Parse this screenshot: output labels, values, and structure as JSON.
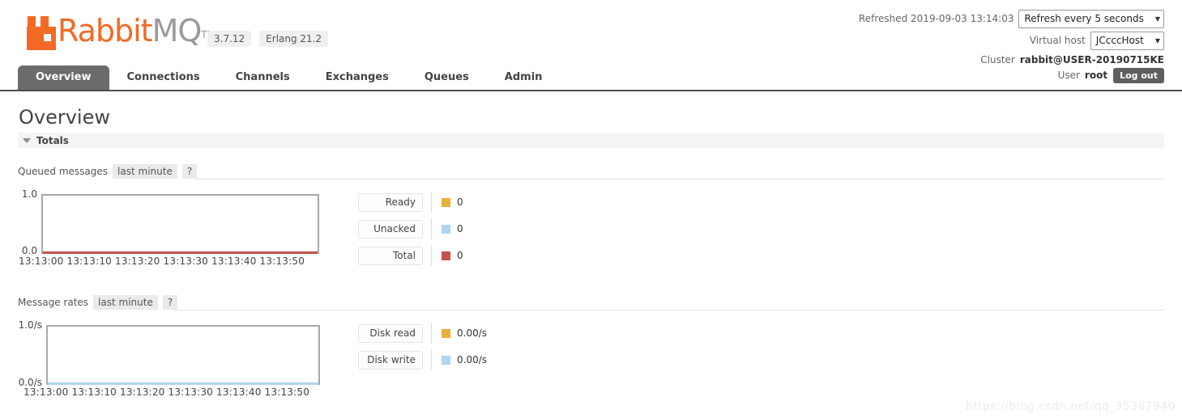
{
  "app": {
    "brand_primary": "RabbitMQ",
    "brand_rabbit": "Rabbit",
    "brand_mq": "MQ",
    "brand_tm": "TM",
    "version": "3.7.12",
    "erlang_version": "Erlang 21.2",
    "logo_color": "#f26a25"
  },
  "header": {
    "refreshed_label": "Refreshed 2019-09-03 13:14:03",
    "refresh_select": "Refresh every 5 seconds",
    "vhost_label": "Virtual host",
    "vhost_select": "JCcccHost",
    "cluster_label": "Cluster",
    "cluster_value": "rabbit@USER-20190715KE",
    "user_label": "User",
    "user_value": "root",
    "logout_label": "Log out",
    "arrow_glyph": "▼"
  },
  "nav": {
    "items": [
      {
        "label": "Overview",
        "active": true
      },
      {
        "label": "Connections",
        "active": false
      },
      {
        "label": "Channels",
        "active": false
      },
      {
        "label": "Exchanges",
        "active": false
      },
      {
        "label": "Queues",
        "active": false
      },
      {
        "label": "Admin",
        "active": false
      }
    ]
  },
  "page": {
    "title": "Overview",
    "section_totals": "Totals"
  },
  "sections": [
    {
      "caption": "Queued messages",
      "period_tab": "last minute",
      "help": "?",
      "y_top": "1.0",
      "y_bottom": "0.0",
      "x_ticks": "13:13:00 13:13:10 13:13:20 13:13:30 13:13:40 13:13:50",
      "series_color": "#c4524e",
      "legend": [
        {
          "label": "Ready",
          "color": "#e8b13a",
          "value": "0"
        },
        {
          "label": "Unacked",
          "color": "#aed6f1",
          "value": "0"
        },
        {
          "label": "Total",
          "color": "#c4524e",
          "value": "0"
        }
      ]
    },
    {
      "caption": "Message rates",
      "period_tab": "last minute",
      "help": "?",
      "y_top": "1.0/s",
      "y_bottom": "0.0/s",
      "x_ticks": "13:13:00 13:13:10 13:13:20 13:13:30 13:13:40 13:13:50",
      "series_color": "#aed6f1",
      "legend": [
        {
          "label": "Disk read",
          "color": "#e8b13a",
          "value": "0.00/s"
        },
        {
          "label": "Disk write",
          "color": "#aed6f1",
          "value": "0.00/s"
        }
      ]
    }
  ],
  "chart_data": [
    {
      "type": "line",
      "title": "Queued messages",
      "subtitle": "last minute",
      "xlabel": "",
      "ylabel": "",
      "ylim": [
        0,
        1
      ],
      "yticks": [
        "0.0",
        "1.0"
      ],
      "x": [
        "13:13:00",
        "13:13:10",
        "13:13:20",
        "13:13:30",
        "13:13:40",
        "13:13:50"
      ],
      "grid": false,
      "legend_position": "right",
      "series": [
        {
          "name": "Ready",
          "color": "#e8b13a",
          "current": 0,
          "values": [
            0,
            0,
            0,
            0,
            0,
            0
          ]
        },
        {
          "name": "Unacked",
          "color": "#aed6f1",
          "current": 0,
          "values": [
            0,
            0,
            0,
            0,
            0,
            0
          ]
        },
        {
          "name": "Total",
          "color": "#c4524e",
          "current": 0,
          "values": [
            0,
            0,
            0,
            0,
            0,
            0
          ]
        }
      ]
    },
    {
      "type": "line",
      "title": "Message rates",
      "subtitle": "last minute",
      "xlabel": "",
      "ylabel": "",
      "ylim": [
        0,
        1
      ],
      "yticks": [
        "0.0/s",
        "1.0/s"
      ],
      "x": [
        "13:13:00",
        "13:13:10",
        "13:13:20",
        "13:13:30",
        "13:13:40",
        "13:13:50"
      ],
      "grid": false,
      "legend_position": "right",
      "series": [
        {
          "name": "Disk read",
          "color": "#e8b13a",
          "current": "0.00/s",
          "values": [
            0,
            0,
            0,
            0,
            0,
            0
          ]
        },
        {
          "name": "Disk write",
          "color": "#aed6f1",
          "current": "0.00/s",
          "values": [
            0,
            0,
            0,
            0,
            0,
            0
          ]
        }
      ]
    }
  ],
  "watermark": "https://blog.csdn.net/qq_35387940"
}
